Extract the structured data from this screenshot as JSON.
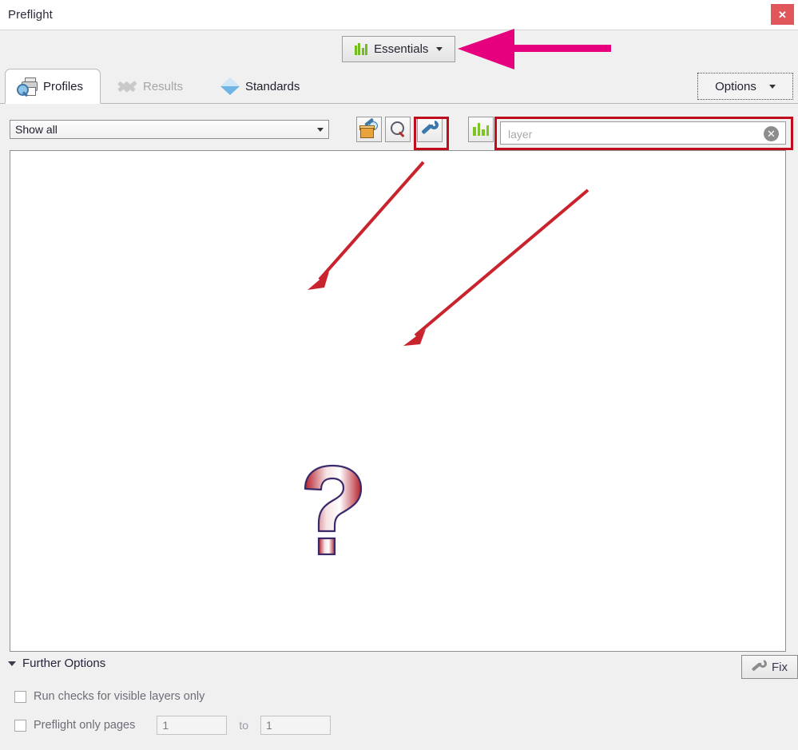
{
  "window": {
    "title": "Preflight",
    "close_label": "✕"
  },
  "workspace": {
    "button_label": "Essentials",
    "icon": "green-bars-icon",
    "caret": "chevron-down-icon"
  },
  "tabs": [
    {
      "label": "Profiles",
      "icon": "printer-magnifier-icon",
      "state": "active"
    },
    {
      "label": "Results",
      "icon": "checkmarks-icon",
      "state": "disabled"
    },
    {
      "label": "Standards",
      "icon": "diamond-icon",
      "state": "enabled"
    }
  ],
  "options": {
    "label": "Options",
    "caret": "chevron-down-icon"
  },
  "filter": {
    "dropdown_value": "Show all",
    "dropdown_caret": "chevron-down-icon",
    "buttons": [
      {
        "name": "fixups-button",
        "icon": "toolbox-wrench-icon"
      },
      {
        "name": "search-button",
        "icon": "magnifier-icon"
      },
      {
        "name": "wrench-button",
        "icon": "wrench-icon"
      },
      {
        "name": "profiles-button",
        "icon": "green-bars-icon"
      }
    ]
  },
  "search": {
    "value": "",
    "placeholder": "layer",
    "clear_label": "✕"
  },
  "list": {
    "empty_icon": "question-mark-graphic",
    "items": []
  },
  "further_options": {
    "label": "Further Options",
    "expander": "triangle-down-icon",
    "visible_layers": {
      "label": "Run checks for visible layers only",
      "checked": false
    },
    "preflight_pages": {
      "label": "Preflight only pages",
      "checked": false,
      "from_value": "1",
      "to_label": "to",
      "to_value": "1"
    }
  },
  "fix": {
    "label": "Fix",
    "icon": "wrench-icon"
  },
  "annotations": {
    "highlight_color": "#c00d1e",
    "arrow_color": "#c9242e",
    "pointer_color": "#e6007e",
    "highlight_boxes": [
      "wrench-button",
      "search-input"
    ],
    "arrows": [
      "arrow-from-wrench",
      "arrow-from-search"
    ],
    "pointer": "magenta-arrow-to-essentials"
  }
}
